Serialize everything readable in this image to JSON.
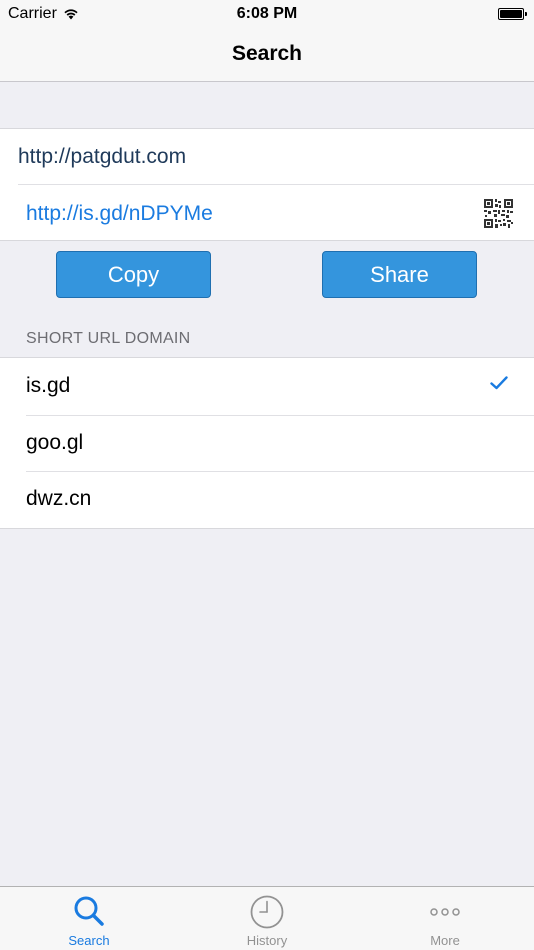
{
  "status_bar": {
    "carrier": "Carrier",
    "time": "6:08 PM"
  },
  "nav": {
    "title": "Search"
  },
  "url_section": {
    "long_url_value": "http://patgdut.com",
    "short_url": "http://is.gd/nDPYMe"
  },
  "actions": {
    "copy_label": "Copy",
    "share_label": "Share"
  },
  "domain_section": {
    "header": "SHORT URL DOMAIN",
    "items": [
      {
        "label": "is.gd",
        "selected": true
      },
      {
        "label": "goo.gl",
        "selected": false
      },
      {
        "label": "dwz.cn",
        "selected": false
      }
    ]
  },
  "tab_bar": {
    "tabs": [
      {
        "label": "Search",
        "icon": "magnifier-icon",
        "active": true
      },
      {
        "label": "History",
        "icon": "clock-icon",
        "active": false
      },
      {
        "label": "More",
        "icon": "more-dots-icon",
        "active": false
      }
    ]
  },
  "colors": {
    "accent": "#1a7be0",
    "button": "#3495dd",
    "background": "#efeff4"
  }
}
